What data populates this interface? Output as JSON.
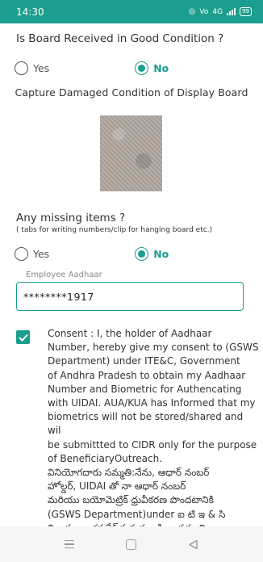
{
  "status_bar": {
    "time": "14:30",
    "icons": [
      "location-icon",
      "volte-icon",
      "wifi-data-icon",
      "signal-icon",
      "battery-icon"
    ],
    "volte_text": "Vo",
    "data_text": "4G",
    "battery_text": "99"
  },
  "form": {
    "question1": "Is Board Received in Good Condition ?",
    "q1_options": {
      "yes": "Yes",
      "no": "No",
      "selected": "No"
    },
    "capture_label": "Capture  Damaged Condition of  Display Board",
    "question2": "Any missing items ?",
    "question2_hint": "( tabs for writing numbers/clip for hanging board etc.)",
    "q2_options": {
      "yes": "Yes",
      "no": "No",
      "selected": "No"
    },
    "aadhaar_label": "Employee Aadhaar",
    "aadhaar_value": "********1917",
    "consent_checked": true,
    "consent_text": "Consent : I, the holder of Aadhaar\nNumber, hereby give my consent to (GSWS\nDepartment) under ITE&C, Government\nof Andhra Pradesh to obtain my Aadhaar\nNumber and Biometric for Authencating\nwith UIDAI. AUA/KUA has Informed that my\nbiometrics will not be stored/shared and wil\nbe submittted to CIDR only for the purpose\nof BeneficiaryOutreach.\nవినియోగదారు సమ్మతి:నేను, ఆధార్ నంబర్\nహోల్డర్, UIDAI తో నా ఆధార్ నంబర్\nమరియు బయోమెట్రిక్ ధ్రువీకరణ పొందటానికి\n(GSWS Department)under ఐ టి ఇ & సి\nవిభాగం,ఆంధ్రప్రదేశ్ ప్రభుత్వం కి నా సమ్మతి\nఇస్తున్నాను.AUA/KUA నా బయోమెట్రిక్\nవివరాలను నిల్వ చేయబడదు/భాగస్వామ్యం చేయబడదని"
  },
  "nav_bar": {
    "buttons": [
      "menu-icon",
      "home-icon",
      "back-icon"
    ]
  },
  "colors": {
    "accent": "#1b9e8e",
    "status_bar": "#1b9e8e",
    "text": "#333333"
  }
}
